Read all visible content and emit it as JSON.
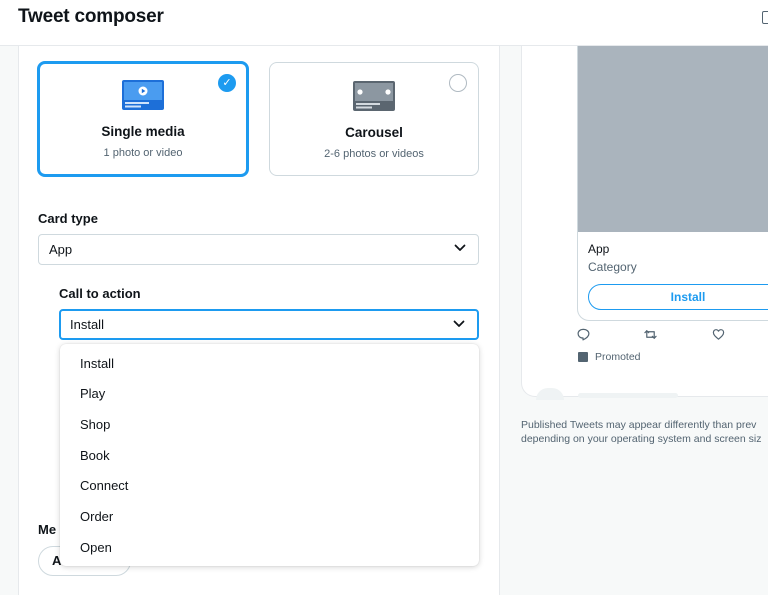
{
  "header": {
    "title": "Tweet composer"
  },
  "media_types": {
    "single": {
      "title": "Single media",
      "subtitle": "1 photo or video",
      "check": "✓"
    },
    "carousel": {
      "title": "Carousel",
      "subtitle": "2-6 photos or videos"
    }
  },
  "card_type": {
    "label": "Card type",
    "value": "App"
  },
  "call_to_action": {
    "label": "Call to action",
    "value": "Install",
    "options": [
      "Install",
      "Play",
      "Shop",
      "Book",
      "Connect",
      "Order",
      "Open"
    ]
  },
  "hidden_section": {
    "label_fragment": "Me",
    "pill_fragment": "A"
  },
  "preview": {
    "app_name": "App",
    "category": "Category",
    "cta_label": "Install",
    "promoted": "Promoted",
    "icons": [
      "reply-icon",
      "retweet-icon",
      "like-icon",
      "promoted-icon"
    ]
  },
  "disclaimer": {
    "line1": "Published Tweets may appear differently than prev",
    "line2": "depending on your operating system and screen siz"
  },
  "colors": {
    "accent": "#1d9bf0",
    "text": "#0f1419",
    "muted": "#536471",
    "border": "#cfd9de",
    "image_placeholder": "#aab4bd",
    "panel_bg": "#f7f9f9"
  }
}
